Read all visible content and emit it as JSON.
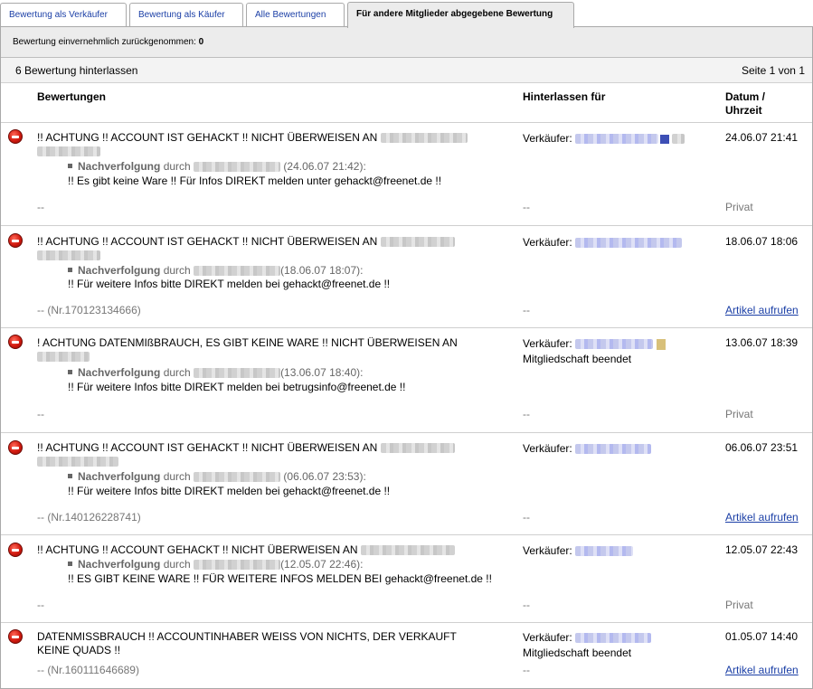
{
  "tabs": [
    {
      "label": "Bewertung als Verkäufer"
    },
    {
      "label": "Bewertung als Käufer"
    },
    {
      "label": "Alle Bewertungen"
    },
    {
      "label": "Für andere Mitglieder abgegebene Bewertung"
    }
  ],
  "subbar": {
    "label": "Bewertung einvernehmlich zurückgenommen:",
    "value": "0"
  },
  "countbar": {
    "count": "6 Bewertung hinterlassen",
    "page": "Seite 1 von 1"
  },
  "headers": {
    "col1": "Bewertungen",
    "col2": "Hinterlassen für",
    "col3a": "Datum /",
    "col3b": "Uhrzeit"
  },
  "colors": {
    "link": "#1b3fa6",
    "negative_icon": "#d11a0f"
  },
  "icons": {
    "negative": "negative-feedback-icon"
  },
  "followup_label": "Nachverfolgung",
  "followup_by": "durch",
  "seller_label": "Verkäufer:",
  "rows": [
    {
      "title": "!! ACHTUNG !! ACCOUNT IST GEHACKT !! NICHT ÜBERWEISEN AN",
      "followup_time": "(24.06.07 21:42):",
      "followup_msg": "!! Es gibt keine Ware !! Für Infos DIREKT melden unter gehackt@freenet.de !!",
      "bottom": "--",
      "seller_bottom": "--",
      "date": "24.06.07 21:41",
      "status": "Privat"
    },
    {
      "title": "!! ACHTUNG !! ACCOUNT IST GEHACKT !! NICHT ÜBERWEISEN AN",
      "followup_time": "(18.06.07 18:07):",
      "followup_msg": "!! Für weitere Infos bitte DIREKT melden bei gehackt@freenet.de !!",
      "bottom": "-- (Nr.170123134666)",
      "seller_bottom": "--",
      "date": "18.06.07 18:06",
      "status": "Artikel aufrufen"
    },
    {
      "title": "! ACHTUNG DATENMIßBRAUCH, ES GIBT KEINE WARE !! NICHT ÜBERWEISEN AN",
      "followup_time": "(13.06.07 18:40):",
      "followup_msg": "!! Für weitere Infos bitte DIREKT melden bei betrugsinfo@freenet.de !!",
      "bottom": "--",
      "seller_bottom": "--",
      "seller_extra": "Mitgliedschaft beendet",
      "date": "13.06.07 18:39",
      "status": "Privat"
    },
    {
      "title": "!! ACHTUNG !! ACCOUNT IST GEHACKT !! NICHT ÜBERWEISEN AN",
      "followup_time": "(06.06.07 23:53):",
      "followup_msg": "!! Für weitere Infos bitte DIREKT melden bei gehackt@freenet.de !!",
      "bottom": "-- (Nr.140126228741)",
      "seller_bottom": "--",
      "date": "06.06.07 23:51",
      "status": "Artikel aufrufen"
    },
    {
      "title": "!! ACHTUNG !! ACCOUNT GEHACKT !! NICHT ÜBERWEISEN AN",
      "followup_time": "(12.05.07 22:46):",
      "followup_msg": "!! ES GIBT KEINE WARE !! FÜR WEITERE INFOS MELDEN BEI gehackt@freenet.de !!",
      "bottom": "--",
      "seller_bottom": "--",
      "date": "12.05.07 22:43",
      "status": "Privat"
    },
    {
      "title_line1": "DATENMISSBRAUCH !! ACCOUNTINHABER WEISS VON NICHTS, DER VERKAUFT",
      "title_line2": "KEINE QUADS !!",
      "bottom": "-- (Nr.160111646689)",
      "seller_bottom": "--",
      "seller_extra": "Mitgliedschaft beendet",
      "date": "01.05.07 14:40",
      "status": "Artikel aufrufen"
    }
  ]
}
